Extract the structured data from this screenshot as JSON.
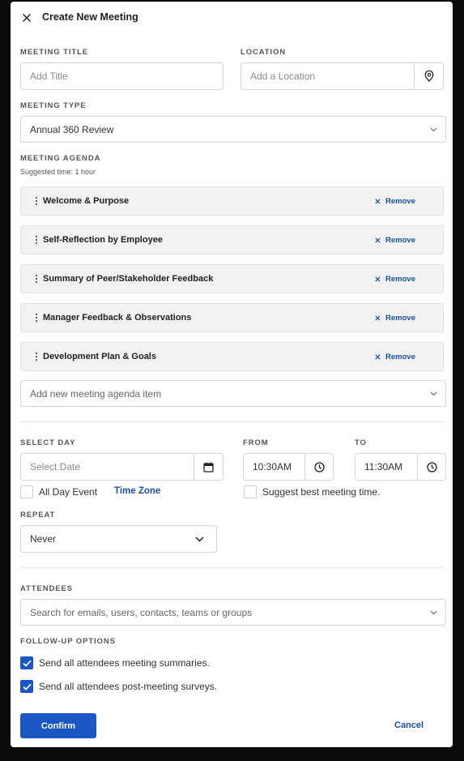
{
  "header": {
    "title": "Create New Meeting"
  },
  "meeting_title": {
    "label": "MEETING TITLE",
    "placeholder": "Add Title"
  },
  "location": {
    "label": "LOCATION",
    "placeholder": "Add a Location"
  },
  "meeting_type": {
    "label": "MEETING TYPE",
    "value": "Annual 360 Review"
  },
  "agenda": {
    "label": "MEETING AGENDA",
    "hint": "Suggested time: 1 hour",
    "remove_label": "Remove",
    "items": [
      {
        "label": "Welcome & Purpose"
      },
      {
        "label": "Self-Reflection by Employee"
      },
      {
        "label": "Summary of Peer/Stakeholder Feedback"
      },
      {
        "label": "Manager Feedback & Observations"
      },
      {
        "label": "Development Plan & Goals"
      }
    ],
    "add_placeholder": "Add new meeting agenda item"
  },
  "schedule": {
    "day_label": "SELECT DAY",
    "day_placeholder": "Select Date",
    "from_label": "FROM",
    "from_value": "10:30AM",
    "to_label": "TO",
    "to_value": "11:30AM",
    "all_day_label": "All Day Event",
    "all_day_checked": false,
    "timezone_label": "Time Zone",
    "suggest_label": "Suggest best meeting time.",
    "suggest_checked": false
  },
  "repeat": {
    "label": "REPEAT",
    "value": "Never"
  },
  "attendees": {
    "label": "ATTENDEES",
    "placeholder": "Search for emails, users, contacts, teams or groups"
  },
  "followup": {
    "label": "FOLLOW-UP OPTIONS",
    "options": [
      {
        "label": "Send all attendees meeting summaries.",
        "checked": true
      },
      {
        "label": "Send all attendees post-meeting surveys.",
        "checked": true
      }
    ]
  },
  "actions": {
    "confirm": "Confirm",
    "cancel": "Cancel"
  },
  "colors": {
    "primary": "#1a56c4",
    "link": "#1a4fa0",
    "agenda_bg": "#f2f2f3"
  }
}
